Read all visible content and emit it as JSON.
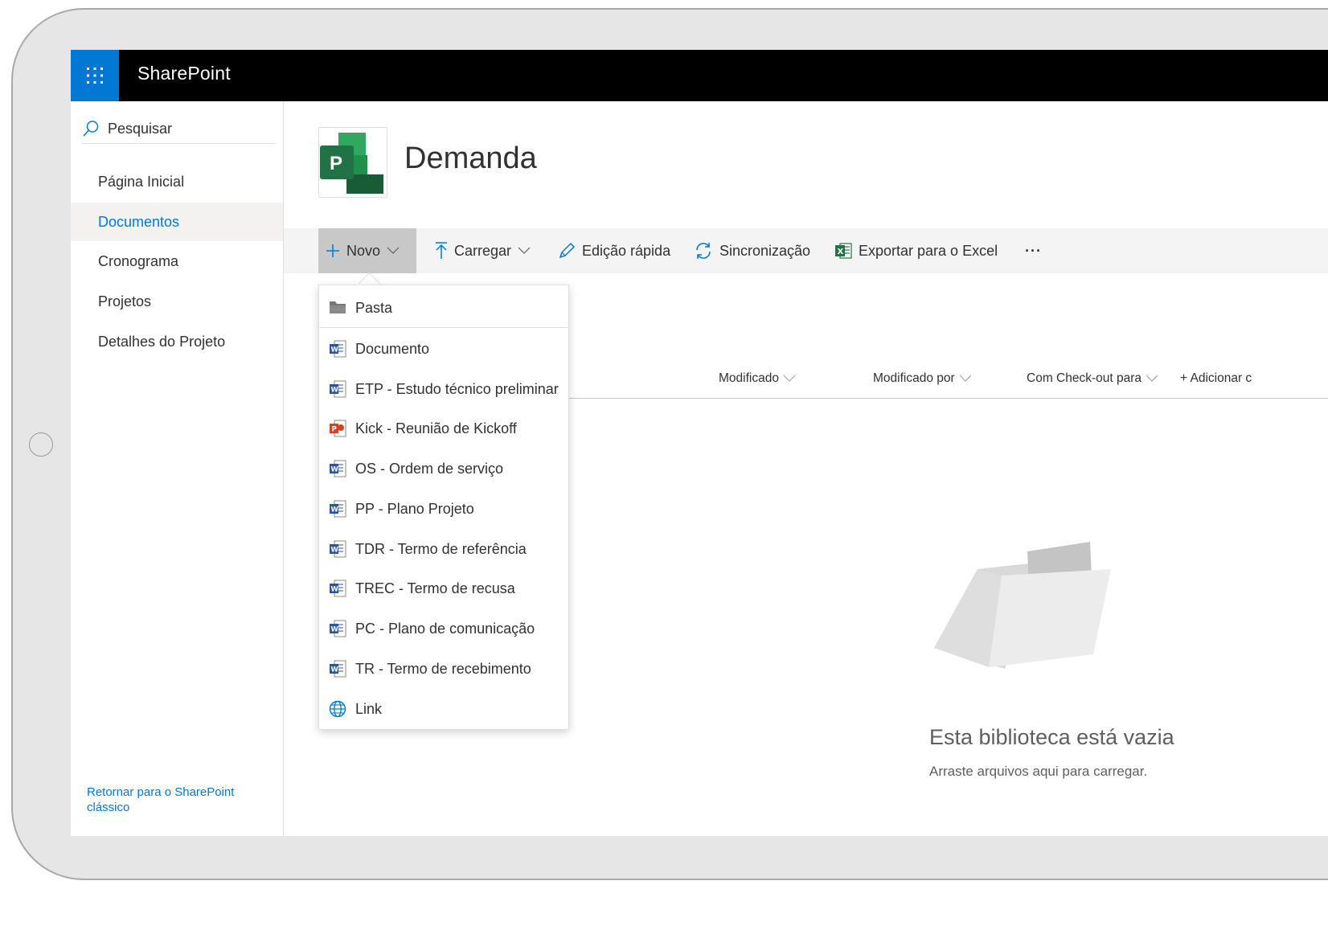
{
  "app": {
    "title": "SharePoint"
  },
  "nav": {
    "search_label": "Pesquisar",
    "items": [
      {
        "label": "Página Inicial",
        "selected": false
      },
      {
        "label": "Documentos",
        "selected": true
      },
      {
        "label": "Cronograma",
        "selected": false
      },
      {
        "label": "Projetos",
        "selected": false
      },
      {
        "label": "Detalhes do Projeto",
        "selected": false
      }
    ],
    "classic_link": "Retornar para o SharePoint clássico"
  },
  "site": {
    "title": "Demanda",
    "logo_letter": "P"
  },
  "commands": {
    "new": "Novo",
    "upload": "Carregar",
    "quick_edit": "Edição rápida",
    "sync": "Sincronização",
    "export_excel": "Exportar para o Excel",
    "more": "···"
  },
  "columns": {
    "modified": "Modificado",
    "modified_by": "Modificado por",
    "checked_out": "Com Check-out para",
    "add_column": "+ Adicionar c"
  },
  "new_menu": {
    "items": [
      {
        "label": "Pasta",
        "icon": "folder-icon"
      },
      {
        "label": "Documento",
        "icon": "word-icon"
      },
      {
        "label": "ETP - Estudo técnico preliminar",
        "icon": "word-icon"
      },
      {
        "label": "Kick - Reunião de Kickoff",
        "icon": "powerpoint-icon"
      },
      {
        "label": "OS - Ordem de serviço",
        "icon": "word-icon"
      },
      {
        "label": "PP - Plano Projeto",
        "icon": "word-icon"
      },
      {
        "label": "TDR - Termo de referência",
        "icon": "word-icon"
      },
      {
        "label": "TREC - Termo de recusa",
        "icon": "word-icon"
      },
      {
        "label": "PC - Plano de comunicação",
        "icon": "word-icon"
      },
      {
        "label": "TR - Termo de recebimento",
        "icon": "word-icon"
      },
      {
        "label": "Link",
        "icon": "globe-icon"
      }
    ]
  },
  "empty_state": {
    "title": "Esta biblioteca está vazia",
    "subtitle": "Arraste arquivos aqui para carregar."
  },
  "colors": {
    "accent": "#0078d4",
    "suitebar": "#000000",
    "project_green": "#217346"
  }
}
